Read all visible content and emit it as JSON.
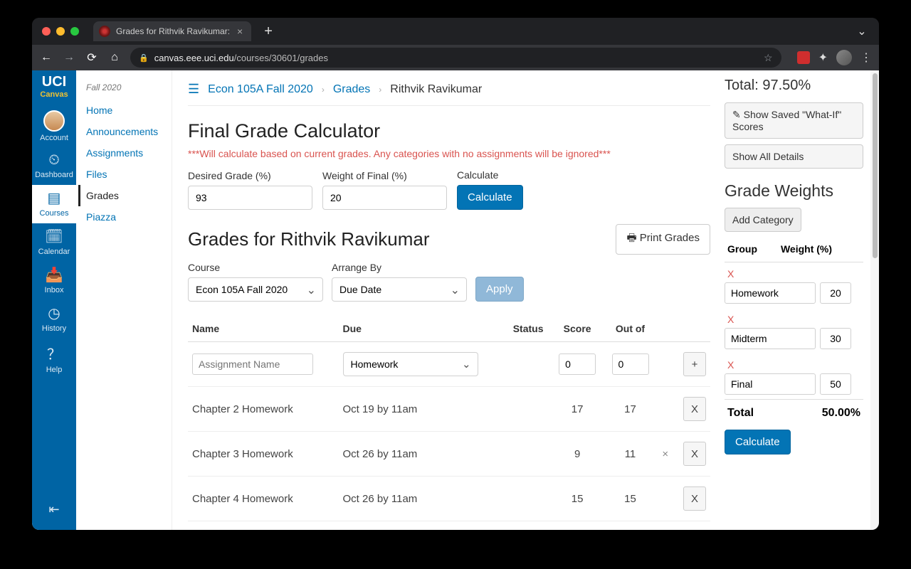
{
  "browser": {
    "tab_title": "Grades for Rithvik Ravikumar:",
    "url_host": "canvas.eee.uci.edu",
    "url_path": "/courses/30601/grades"
  },
  "brand": {
    "top": "UCI",
    "sub": "Canvas"
  },
  "gnav": [
    {
      "key": "account",
      "label": "Account"
    },
    {
      "key": "dashboard",
      "label": "Dashboard"
    },
    {
      "key": "courses",
      "label": "Courses"
    },
    {
      "key": "calendar",
      "label": "Calendar"
    },
    {
      "key": "inbox",
      "label": "Inbox"
    },
    {
      "key": "history",
      "label": "History"
    },
    {
      "key": "help",
      "label": "Help"
    }
  ],
  "cnav": {
    "term": "Fall 2020",
    "items": [
      "Home",
      "Announcements",
      "Assignments",
      "Files",
      "Grades",
      "Piazza"
    ],
    "active": "Grades"
  },
  "crumbs": {
    "course": "Econ 105A Fall 2020",
    "section": "Grades",
    "current": "Rithvik Ravikumar"
  },
  "calc": {
    "title": "Final Grade Calculator",
    "warning": "***Will calculate based on current grades. Any categories with no assignments will be ignored***",
    "desired_label": "Desired Grade (%)",
    "desired_value": "93",
    "weight_label": "Weight of Final (%)",
    "weight_value": "20",
    "calc_label": "Calculate",
    "calc_button": "Calculate"
  },
  "grades": {
    "title": "Grades for Rithvik Ravikumar",
    "print": "Print Grades",
    "course_label": "Course",
    "course_value": "Econ 105A Fall 2020",
    "arrange_label": "Arrange By",
    "arrange_value": "Due Date",
    "apply": "Apply",
    "headers": {
      "name": "Name",
      "due": "Due",
      "status": "Status",
      "score": "Score",
      "out": "Out of"
    },
    "new_row": {
      "placeholder": "Assignment Name",
      "category": "Homework",
      "score": "0",
      "out": "0",
      "add": "+"
    },
    "rows": [
      {
        "name": "Chapter 2 Homework",
        "due": "Oct 19 by 11am",
        "score": "17",
        "out": "17",
        "extra": "",
        "btn": "X"
      },
      {
        "name": "Chapter 3 Homework",
        "due": "Oct 26 by 11am",
        "score": "9",
        "out": "11",
        "extra": "×",
        "btn": "X"
      },
      {
        "name": "Chapter 4 Homework",
        "due": "Oct 26 by 11am",
        "score": "15",
        "out": "15",
        "extra": "",
        "btn": "X"
      }
    ]
  },
  "side": {
    "total": "Total: 97.50%",
    "whatif": "Show Saved \"What-If\" Scores",
    "showall": "Show All Details",
    "weights_title": "Grade Weights",
    "addcat": "Add Category",
    "group_h": "Group",
    "weight_h": "Weight (%)",
    "cats": [
      {
        "name": "Homework",
        "pct": "20"
      },
      {
        "name": "Midterm",
        "pct": "30"
      },
      {
        "name": "Final",
        "pct": "50"
      }
    ],
    "total_label": "Total",
    "total_pct": "50.00%",
    "calc": "Calculate"
  }
}
